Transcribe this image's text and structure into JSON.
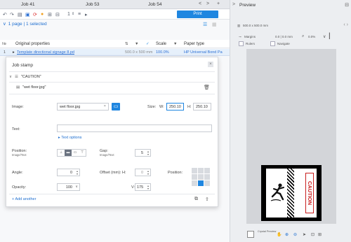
{
  "tabs": [
    "Job 41",
    "Job 53",
    "Job 54"
  ],
  "tab_controls": [
    "<",
    ">",
    "+"
  ],
  "toolbar": {
    "stepper_value": "1",
    "print_label": "Print"
  },
  "page_selection": "1 page | 1 selected",
  "table": {
    "columns": [
      "Original properties",
      "Scale",
      "Paper type"
    ],
    "row": {
      "num": "1",
      "name": "Template directional signage 8.pdf",
      "size": "500.0 x 500 mm",
      "scale": "100.0%",
      "paper": "HP Universal Bond Pa"
    }
  },
  "dialog": {
    "title": "Job stamp",
    "stamp_text_item": "\"CAUTION\"",
    "stamp_image_item": "\"wet floor.jpg\"",
    "image_label": "Image:",
    "image_value": "wet floor.jpg",
    "size_label": "Size:",
    "w_label": "W:",
    "w_value": "250.10",
    "h_label": "H:",
    "h_value": "250.10",
    "text_label": "Text:",
    "text_value": "",
    "text_options": "Text options",
    "position_label": "Position:",
    "position_sub": "Image/Text",
    "gap_label": "Gap:",
    "gap_sub": "Image/Text",
    "gap_value": "5",
    "angle_label": "Angle:",
    "angle_value": "0",
    "offset_label": "Offset (mm): H:",
    "offset_h_value": "0",
    "v_label": "V:",
    "v_value": "175",
    "position2_label": "Position:",
    "opacity_label": "Opacity:",
    "opacity_value": "100",
    "add_another": "Add another"
  },
  "preview": {
    "title": "Preview",
    "size_text": "500.0 x 500.0 mm",
    "margins_label": "Margins",
    "zoom_text": "0.0 | 0.0 mm",
    "zoom_pct": "0.0%",
    "rulers_label": "Rulers",
    "navigate_label": "Navigate",
    "stamp_text": "CAUTION",
    "bottom_label": "Crystal Preview"
  },
  "colors": {
    "accent": "#1f86e0",
    "stamp_red": "#c81e1e"
  }
}
